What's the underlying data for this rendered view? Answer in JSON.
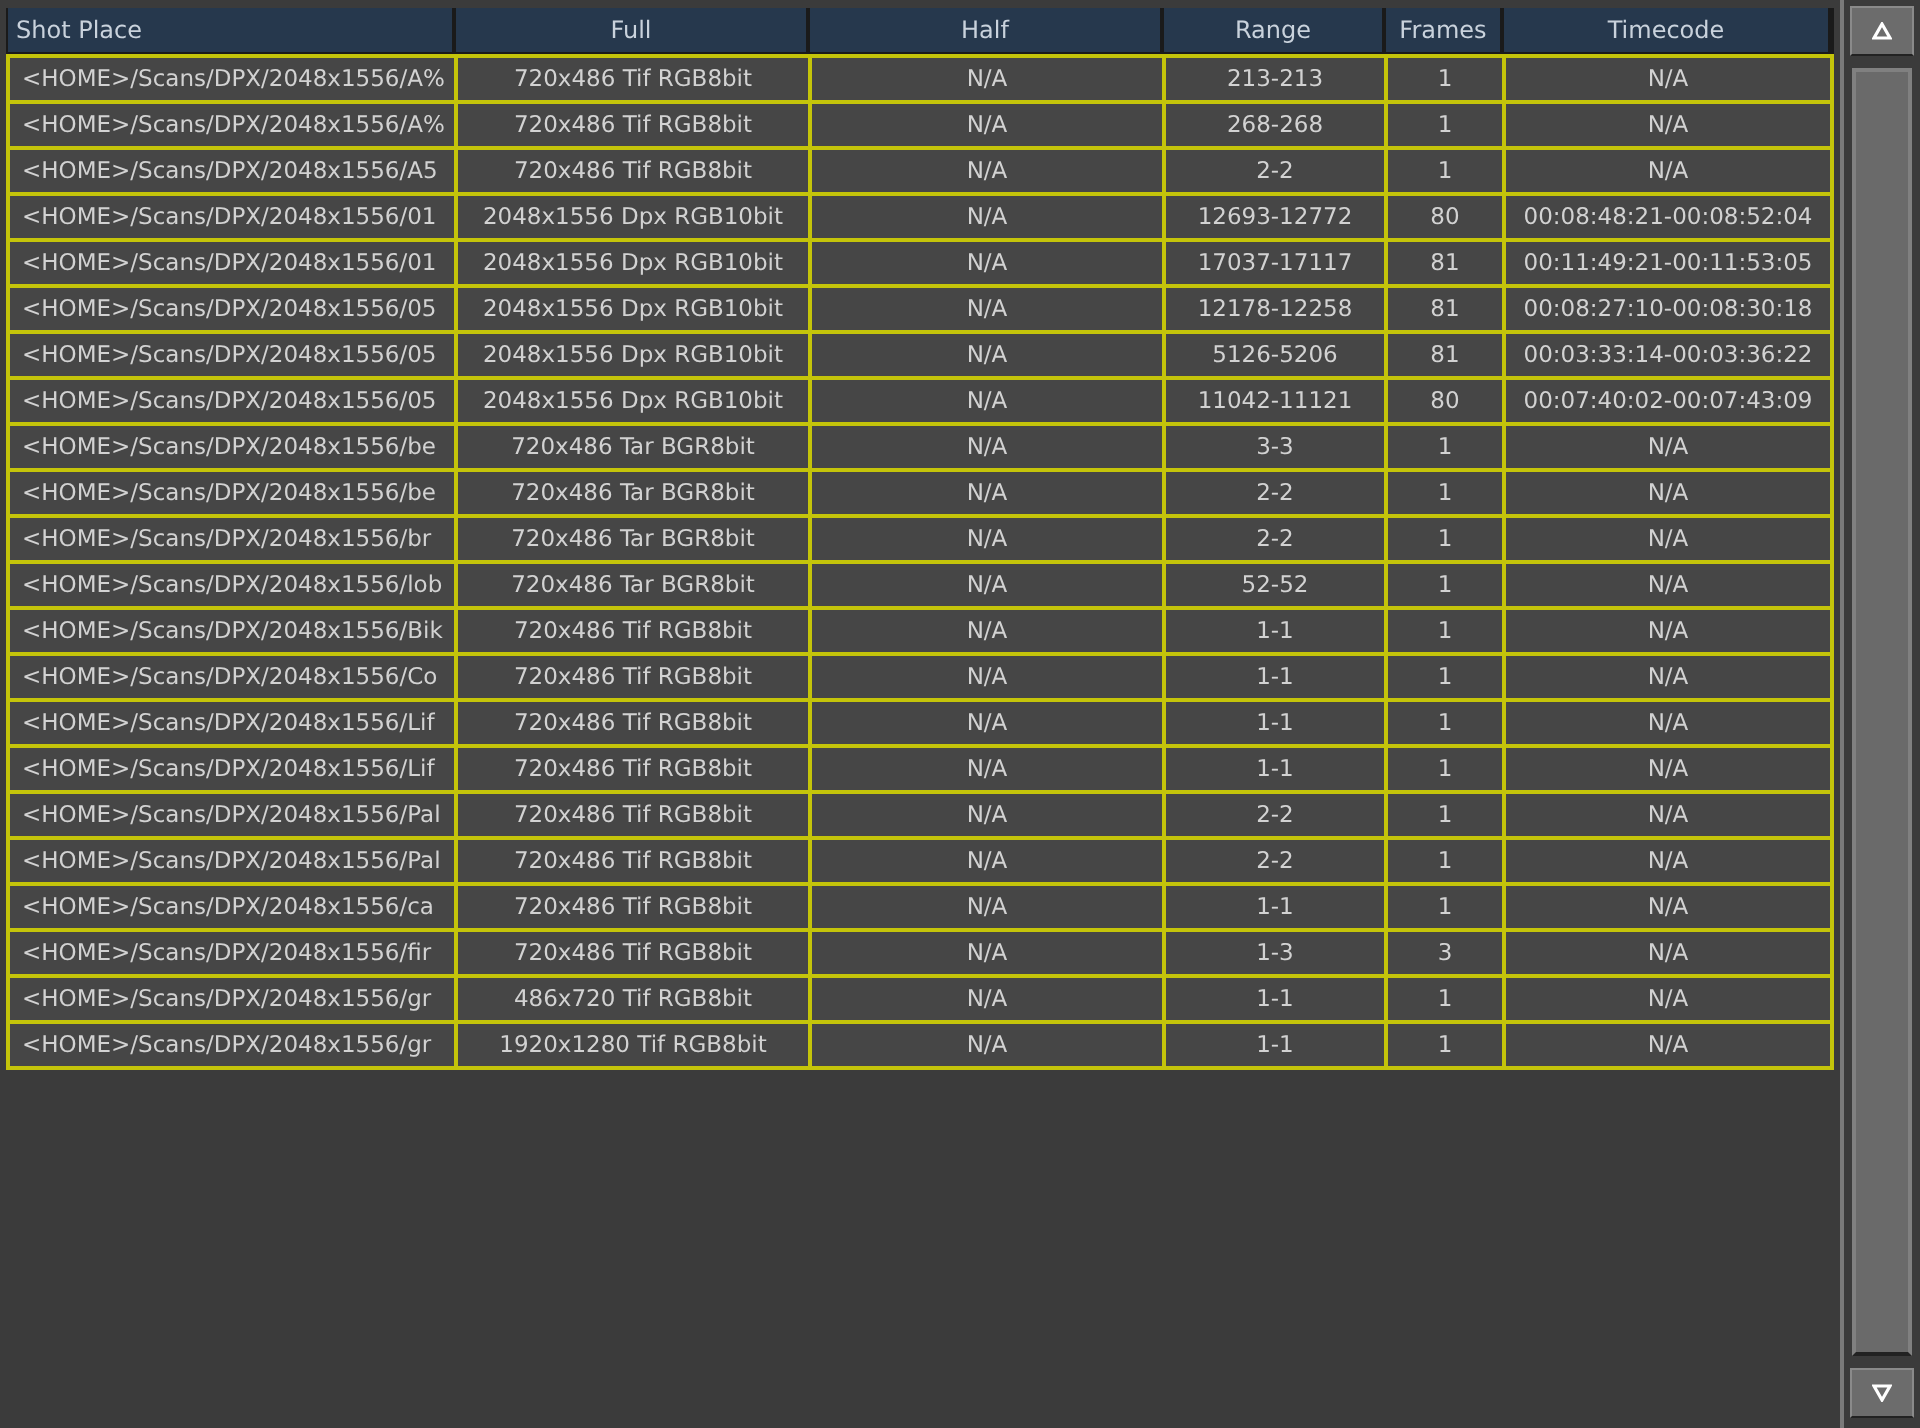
{
  "table": {
    "columns": [
      "Shot Place",
      "Full",
      "Half",
      "Range",
      "Frames",
      "Timecode"
    ],
    "rows": [
      {
        "shot_place": "<HOME>/Scans/DPX/2048x1556/A%",
        "full": "720x486 Tif RGB8bit",
        "half": "N/A",
        "range": "213-213",
        "frames": "1",
        "timecode": "N/A"
      },
      {
        "shot_place": "<HOME>/Scans/DPX/2048x1556/A%",
        "full": "720x486 Tif RGB8bit",
        "half": "N/A",
        "range": "268-268",
        "frames": "1",
        "timecode": "N/A"
      },
      {
        "shot_place": "<HOME>/Scans/DPX/2048x1556/A5",
        "full": "720x486 Tif RGB8bit",
        "half": "N/A",
        "range": "2-2",
        "frames": "1",
        "timecode": "N/A"
      },
      {
        "shot_place": "<HOME>/Scans/DPX/2048x1556/01",
        "full": "2048x1556 Dpx RGB10bit",
        "half": "N/A",
        "range": "12693-12772",
        "frames": "80",
        "timecode": "00:08:48:21-00:08:52:04"
      },
      {
        "shot_place": "<HOME>/Scans/DPX/2048x1556/01",
        "full": "2048x1556 Dpx RGB10bit",
        "half": "N/A",
        "range": "17037-17117",
        "frames": "81",
        "timecode": "00:11:49:21-00:11:53:05"
      },
      {
        "shot_place": "<HOME>/Scans/DPX/2048x1556/05",
        "full": "2048x1556 Dpx RGB10bit",
        "half": "N/A",
        "range": "12178-12258",
        "frames": "81",
        "timecode": "00:08:27:10-00:08:30:18"
      },
      {
        "shot_place": "<HOME>/Scans/DPX/2048x1556/05",
        "full": "2048x1556 Dpx RGB10bit",
        "half": "N/A",
        "range": "5126-5206",
        "frames": "81",
        "timecode": "00:03:33:14-00:03:36:22"
      },
      {
        "shot_place": "<HOME>/Scans/DPX/2048x1556/05",
        "full": "2048x1556 Dpx RGB10bit",
        "half": "N/A",
        "range": "11042-11121",
        "frames": "80",
        "timecode": "00:07:40:02-00:07:43:09"
      },
      {
        "shot_place": "<HOME>/Scans/DPX/2048x1556/be",
        "full": "720x486 Tar BGR8bit",
        "half": "N/A",
        "range": "3-3",
        "frames": "1",
        "timecode": "N/A"
      },
      {
        "shot_place": "<HOME>/Scans/DPX/2048x1556/be",
        "full": "720x486 Tar BGR8bit",
        "half": "N/A",
        "range": "2-2",
        "frames": "1",
        "timecode": "N/A"
      },
      {
        "shot_place": "<HOME>/Scans/DPX/2048x1556/br",
        "full": "720x486 Tar BGR8bit",
        "half": "N/A",
        "range": "2-2",
        "frames": "1",
        "timecode": "N/A"
      },
      {
        "shot_place": "<HOME>/Scans/DPX/2048x1556/lob",
        "full": "720x486 Tar BGR8bit",
        "half": "N/A",
        "range": "52-52",
        "frames": "1",
        "timecode": "N/A"
      },
      {
        "shot_place": "<HOME>/Scans/DPX/2048x1556/Bik",
        "full": "720x486 Tif RGB8bit",
        "half": "N/A",
        "range": "1-1",
        "frames": "1",
        "timecode": "N/A"
      },
      {
        "shot_place": "<HOME>/Scans/DPX/2048x1556/Co",
        "full": "720x486 Tif RGB8bit",
        "half": "N/A",
        "range": "1-1",
        "frames": "1",
        "timecode": "N/A"
      },
      {
        "shot_place": "<HOME>/Scans/DPX/2048x1556/Lif",
        "full": "720x486 Tif RGB8bit",
        "half": "N/A",
        "range": "1-1",
        "frames": "1",
        "timecode": "N/A"
      },
      {
        "shot_place": "<HOME>/Scans/DPX/2048x1556/Lif",
        "full": "720x486 Tif RGB8bit",
        "half": "N/A",
        "range": "1-1",
        "frames": "1",
        "timecode": "N/A"
      },
      {
        "shot_place": "<HOME>/Scans/DPX/2048x1556/Pal",
        "full": "720x486 Tif RGB8bit",
        "half": "N/A",
        "range": "2-2",
        "frames": "1",
        "timecode": "N/A"
      },
      {
        "shot_place": "<HOME>/Scans/DPX/2048x1556/Pal",
        "full": "720x486 Tif RGB8bit",
        "half": "N/A",
        "range": "2-2",
        "frames": "1",
        "timecode": "N/A"
      },
      {
        "shot_place": "<HOME>/Scans/DPX/2048x1556/ca",
        "full": "720x486 Tif RGB8bit",
        "half": "N/A",
        "range": "1-1",
        "frames": "1",
        "timecode": "N/A"
      },
      {
        "shot_place": "<HOME>/Scans/DPX/2048x1556/fir",
        "full": "720x486 Tif RGB8bit",
        "half": "N/A",
        "range": "1-3",
        "frames": "3",
        "timecode": "N/A"
      },
      {
        "shot_place": "<HOME>/Scans/DPX/2048x1556/gr",
        "full": "486x720 Tif RGB8bit",
        "half": "N/A",
        "range": "1-1",
        "frames": "1",
        "timecode": "N/A"
      },
      {
        "shot_place": "<HOME>/Scans/DPX/2048x1556/gr",
        "full": "1920x1280 Tif RGB8bit",
        "half": "N/A",
        "range": "1-1",
        "frames": "1",
        "timecode": "N/A"
      }
    ]
  }
}
